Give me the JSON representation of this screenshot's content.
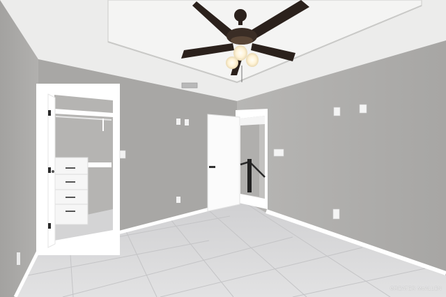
{
  "scene": {
    "description_tag": "empty-bedroom-photo",
    "colors": {
      "wall": "#a9a8a6",
      "wall_light": "#b8b7b5",
      "ceiling": "#eeeeec",
      "floor": "#d9d9da",
      "trim": "#ffffff",
      "fan_blade": "#2b211c",
      "fan_light": "#fff3d6"
    }
  },
  "watermark": {
    "text": "GREATER McALLEN"
  }
}
